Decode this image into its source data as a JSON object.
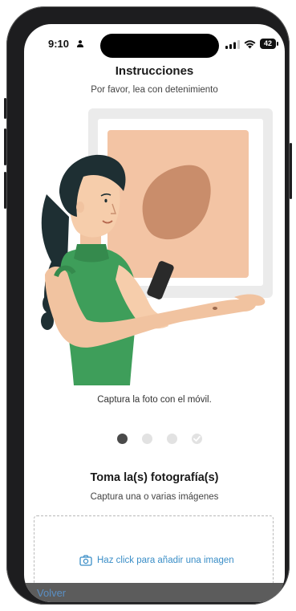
{
  "status_bar": {
    "time": "9:10",
    "battery": "42"
  },
  "header": {
    "title": "Instrucciones",
    "subtitle": "Por favor, lea con detenimiento"
  },
  "step": {
    "caption": "Captura la foto con el móvil.",
    "current_index": 1,
    "total": 4
  },
  "photo_section": {
    "title": "Toma la(s) fotografía(s)",
    "subtitle": "Captura una o varias imágenes",
    "add_image_label": "Haz click para añadir una imagen"
  },
  "footer": {
    "back_label": "Volver"
  },
  "colors": {
    "accent": "#3a8ec7",
    "skin_card": "#f3c4a4",
    "mole": "#c98d6b",
    "shirt": "#3e9e5a",
    "hair": "#1e2f33"
  }
}
